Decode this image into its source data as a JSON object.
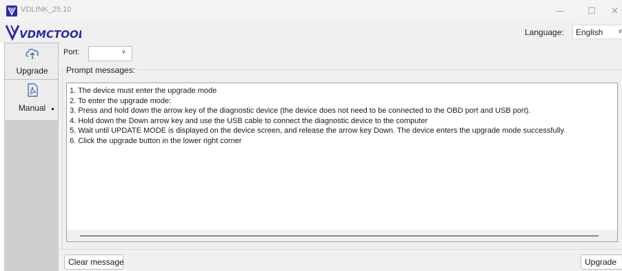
{
  "window": {
    "title": "VDLINK_25.10",
    "minimize": "—",
    "maximize": "☐",
    "close": "✕"
  },
  "header": {
    "logo_text": "VDMCTOOL",
    "language_label": "Language:",
    "language_value": "English"
  },
  "sidebar": {
    "items": [
      {
        "label": "Upgrade",
        "icon": "cloud-upload-icon"
      },
      {
        "label": "Manual",
        "icon": "pdf-document-icon"
      }
    ]
  },
  "main": {
    "port_label": "Port:",
    "port_value": "",
    "prompt_label": "Prompt messages:",
    "messages": [
      "1. The device must enter the upgrade mode",
      "2. To enter the upgrade mode:",
      "3. Press and hold down the arrow key of the diagnostic device (the device does not need to be connected to the OBD port and USB port).",
      "4. Hold down the Down arrow key and use the USB cable to connect the diagnostic device to the computer",
      "5. Wait until UPDATE MODE is displayed on the device screen, and release the arrow key Down. The device enters the upgrade mode successfully",
      "6. Click the upgrade button in the lower right corner"
    ],
    "clear_button": "Clear message",
    "upgrade_button": "Upgrade"
  },
  "colors": {
    "logo_blue": "#2c2aa6",
    "sidebar_bg": "#cfcfcf",
    "window_bg": "#f0f0f0"
  }
}
